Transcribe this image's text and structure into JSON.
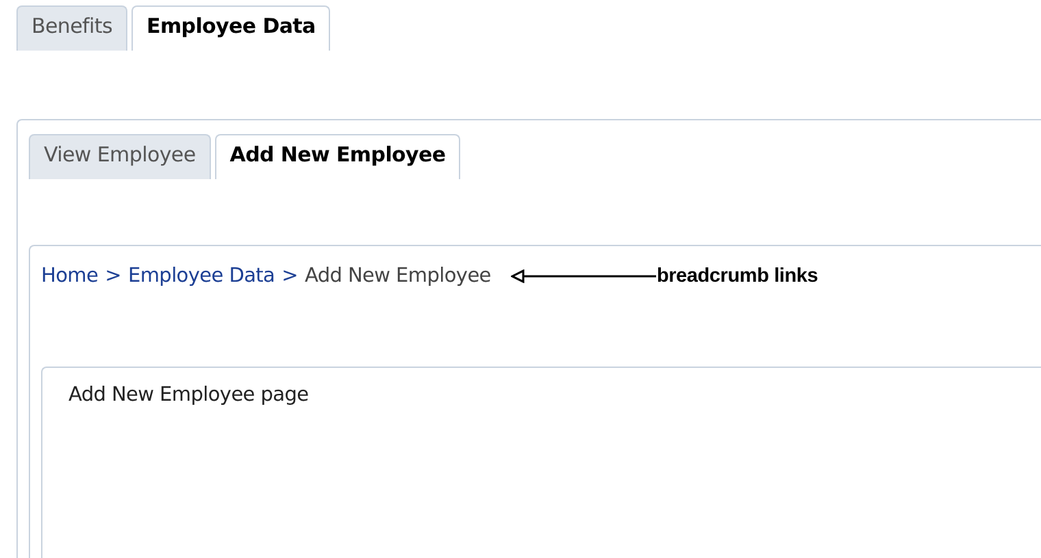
{
  "top_tabs": [
    {
      "label": "Benefits",
      "selected": false
    },
    {
      "label": "Employee Data",
      "selected": true
    }
  ],
  "sub_tabs": [
    {
      "label": "View Employee",
      "selected": false
    },
    {
      "label": "Add New Employee",
      "selected": true
    }
  ],
  "breadcrumb": [
    {
      "label": "Home",
      "kind": "link"
    },
    {
      "label": ">",
      "kind": "separator"
    },
    {
      "label": "Employee Data",
      "kind": "link"
    },
    {
      "label": ">",
      "kind": "separator"
    },
    {
      "label": "Add New Employee",
      "kind": "current"
    }
  ],
  "annotation": {
    "label": "breadcrumb links"
  },
  "content": {
    "text": "Add New Employee page"
  }
}
